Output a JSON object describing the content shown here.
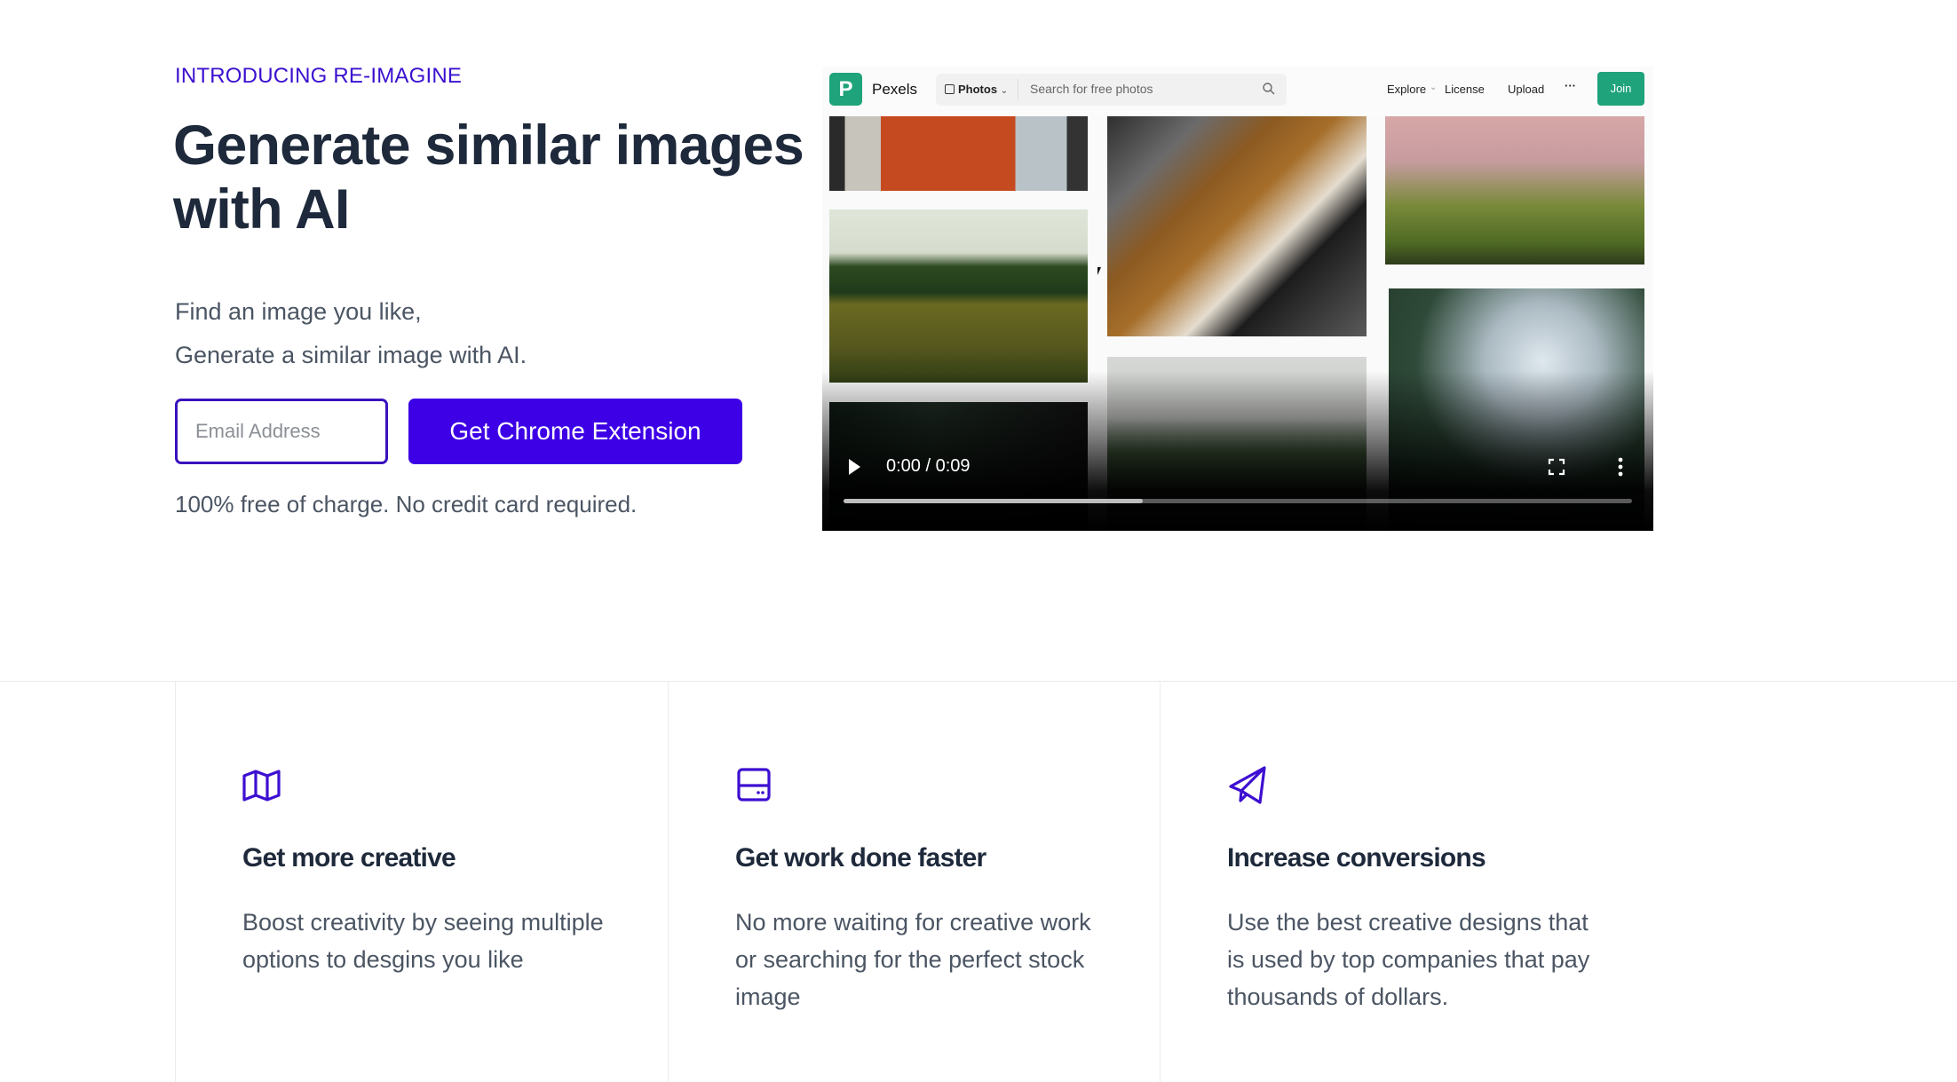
{
  "hero": {
    "eyebrow": "INTRODUCING RE-IMAGINE",
    "headline": "Generate similar images with AI",
    "sub_line_1": "Find an image you like,",
    "sub_line_2": "Generate a similar image with AI.",
    "email_placeholder": "Email Address",
    "email_value": "",
    "cta_label": "Get Chrome Extension",
    "note": "100% free of charge. No credit card required."
  },
  "video": {
    "header": {
      "logo_letter": "P",
      "brand": "Pexels",
      "photos_label": "Photos",
      "search_placeholder": "Search for free photos",
      "nav": [
        "Explore",
        "License",
        "Upload",
        "···"
      ],
      "join_label": "Join"
    },
    "current_time": "0:00",
    "duration": "0:09",
    "time_label": "0:00 / 0:09",
    "buffered_fraction": 0.38
  },
  "features": [
    {
      "icon": "map-icon",
      "title": "Get more creative",
      "body": "Boost creativity by seeing multiple options to desgins you like"
    },
    {
      "icon": "server-icon",
      "title": "Get work done faster",
      "body": "No more waiting for creative work or searching for the perfect stock image"
    },
    {
      "icon": "paper-plane-icon",
      "title": "Increase conversions",
      "body": "Use the best creative designs that is used by top companies that pay thousands of dollars."
    }
  ],
  "colors": {
    "accent": "#3d00e6",
    "eyebrow": "#3b10cf",
    "pexels_green": "#1fa37a"
  }
}
